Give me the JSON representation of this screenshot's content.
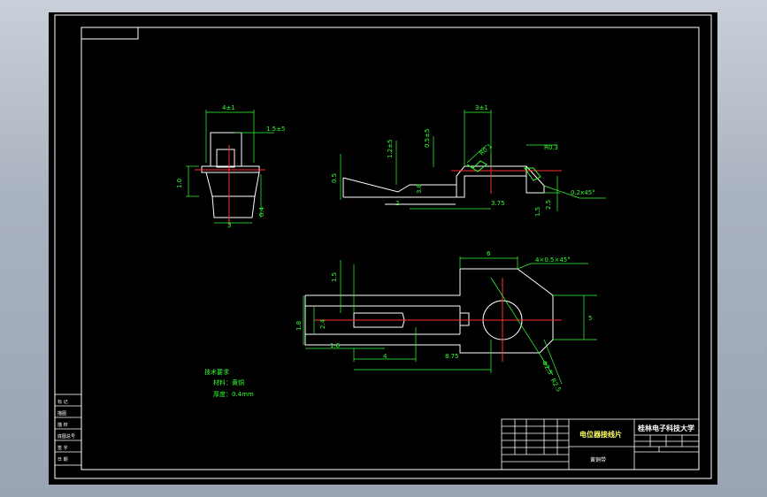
{
  "drawing": {
    "title_block": {
      "part_name": "电位器接线片",
      "school": "桂林电子科技大学",
      "material": "黄铜带"
    },
    "tech_notes": {
      "heading": "技术要求",
      "line1": "材料：黄铜",
      "line2": "厚度：0.4mm"
    },
    "view_top": {
      "d_width_top": "4±1",
      "d_slot": "1.5±5",
      "d_height_left": "1.0",
      "d_thick": "0.4",
      "d_bottom": "3"
    },
    "view_side": {
      "d_h1": "1.2±5",
      "d_h2": "0.5±5",
      "d_h3": "3±1",
      "d_left": "0.5",
      "d_r1": "R0.1",
      "d_r2": "R0.3",
      "d_chamfer": "0.2x45°",
      "d_mid": "3.8",
      "d_len": "3.75",
      "d_small": "2",
      "d_right": "1.5",
      "d_right2": "2.5"
    },
    "view_bottom": {
      "d_top_width": "6",
      "d_chamfer": "4×0.5×45°",
      "d_height": "5",
      "d_left1": "1.5",
      "d_left2": "1.8",
      "d_left3": "2.4",
      "d_small": "1.6",
      "d_four": "4",
      "d_len": "8.75",
      "d_diam": "Φ2.5",
      "d_r": "R2.5"
    },
    "left_strip": {
      "r1": "标 记",
      "r2": "描图",
      "r3": "描 校",
      "r4": "底图总号",
      "r5": "签 字",
      "r6": "日 期"
    }
  }
}
